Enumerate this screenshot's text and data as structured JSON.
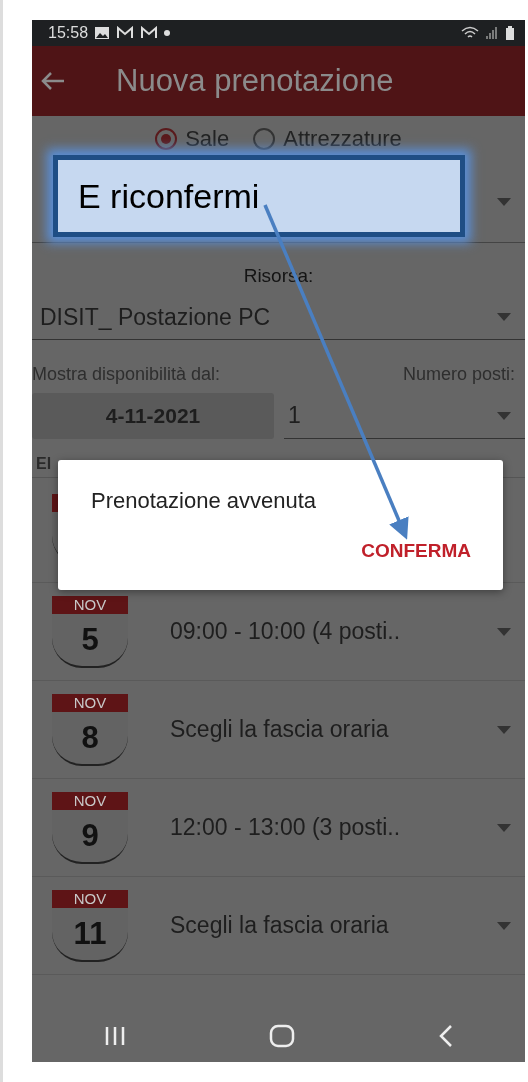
{
  "status_bar": {
    "time": "15:58"
  },
  "app_bar": {
    "title": "Nuova prenotazione"
  },
  "resource_type": [
    {
      "label": "Sale",
      "selected": true
    },
    {
      "label": "Attrezzature",
      "selected": false
    }
  ],
  "resource": {
    "label": "Risorsa:",
    "value": "DISIT_ Postazione PC"
  },
  "availability": {
    "label": "Mostra disponibilità dal:",
    "date": "4-11-2021"
  },
  "seats": {
    "label": "Numero posti:",
    "value": "1"
  },
  "list_header": "El",
  "days": [
    {
      "month": "NOV",
      "day": "5",
      "slot": "09:00 - 10:00 (4 posti.."
    },
    {
      "month": "NOV",
      "day": "8",
      "slot": "Scegli la fascia oraria"
    },
    {
      "month": "NOV",
      "day": "9",
      "slot": "12:00 - 13:00 (3 posti.."
    },
    {
      "month": "NOV",
      "day": "11",
      "slot": "Scegli la fascia oraria"
    }
  ],
  "dialog": {
    "message": "Prenotazione avvenuta",
    "button": "CONFERMA"
  },
  "callout": {
    "text": "E riconfermi"
  }
}
